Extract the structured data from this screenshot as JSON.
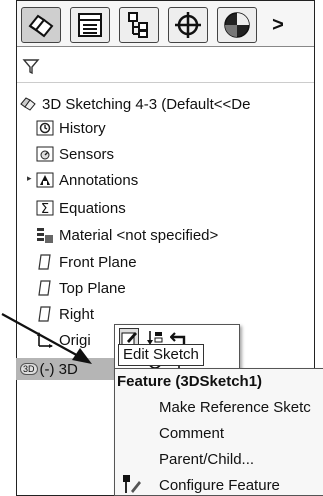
{
  "toolbar": {
    "buttons": [
      {
        "name": "feature-manager-tab",
        "icon": "feature-tree-icon",
        "active": true
      },
      {
        "name": "property-manager-tab",
        "icon": "property-list-icon",
        "active": false
      },
      {
        "name": "configuration-manager-tab",
        "icon": "configuration-icon",
        "active": false
      },
      {
        "name": "dimxpert-manager-tab",
        "icon": "crosshair-icon",
        "active": false
      },
      {
        "name": "display-manager-tab",
        "icon": "appearance-sphere-icon",
        "active": false
      }
    ],
    "more_label": ">"
  },
  "tree": {
    "root": "3D Sketching 4-3  (Default<<De",
    "items": [
      {
        "label": "History",
        "icon": "history-icon"
      },
      {
        "label": "Sensors",
        "icon": "sensors-icon"
      },
      {
        "label": "Annotations",
        "icon": "annotations-icon",
        "expandable": true
      },
      {
        "label": "Equations",
        "icon": "equations-icon"
      },
      {
        "label": "Material <not specified>",
        "icon": "material-icon"
      },
      {
        "label": "Front Plane",
        "icon": "plane-icon"
      },
      {
        "label": "Top Plane",
        "icon": "plane-icon"
      },
      {
        "label": "Right",
        "icon": "plane-icon"
      },
      {
        "label": "Origi",
        "icon": "origin-icon"
      }
    ],
    "selected": {
      "tag": "3D",
      "label": "(-) 3D"
    }
  },
  "context_toolbar": {
    "tooltip": "Edit Sketch"
  },
  "context_menu": {
    "title": "Feature (3DSketch1)",
    "items": [
      "Make Reference Sketc",
      "Comment",
      "Parent/Child...",
      "Configure Feature"
    ]
  },
  "colors": {
    "selection": "#b5b5b5",
    "panel_border": "#222222",
    "menu_bg": "#f7f7f7"
  }
}
